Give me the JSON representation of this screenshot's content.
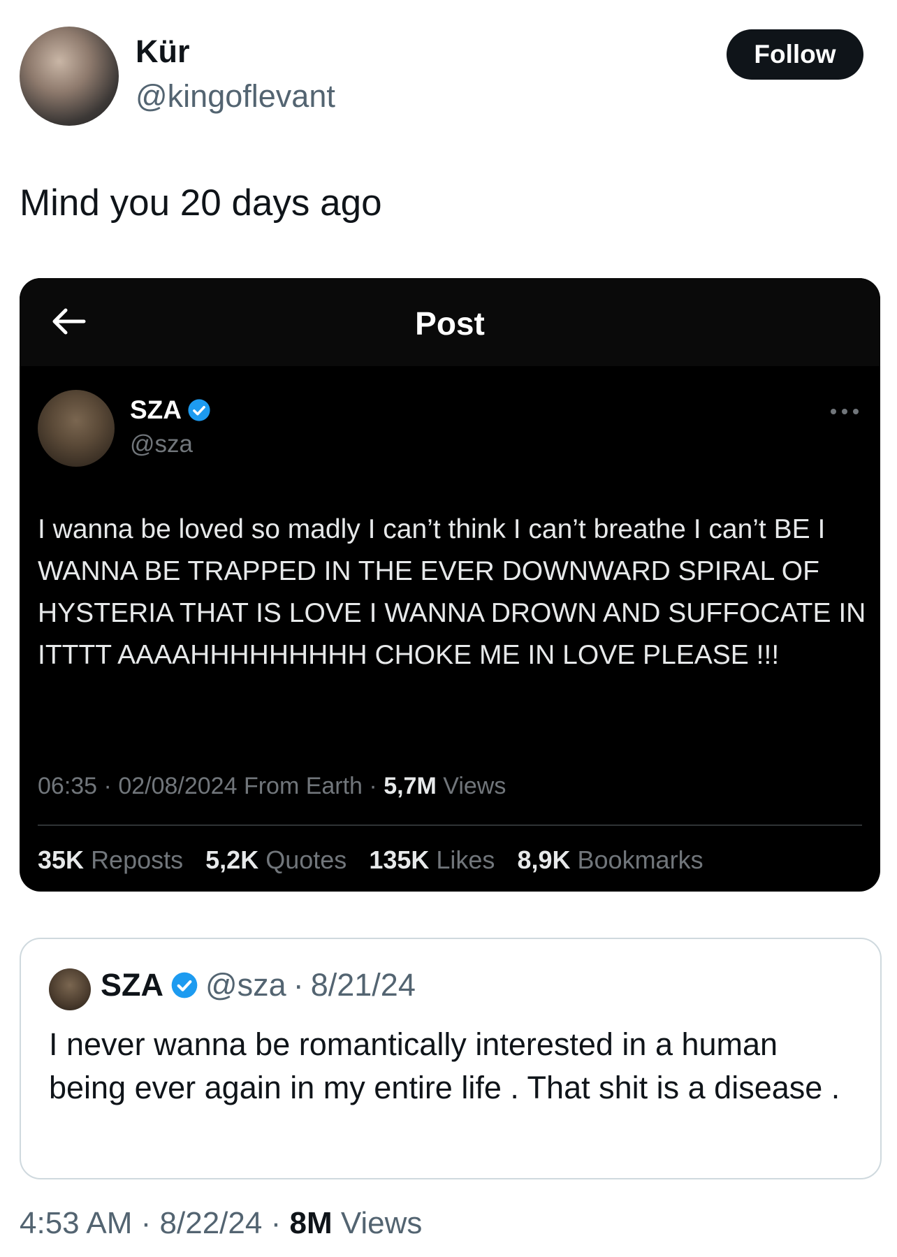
{
  "author": {
    "name": "Kür",
    "handle": "@kingoflevant",
    "follow_label": "Follow"
  },
  "tweet": {
    "text": "Mind you 20 days ago"
  },
  "screenshot": {
    "title": "Post",
    "user": {
      "name": "SZA",
      "handle": "@sza"
    },
    "text": "I wanna be loved so madly I can’t think I can’t breathe I can’t BE I WANNA BE TRAPPED IN THE EVER DOWNWARD SPIRAL OF HYSTERIA THAT IS LOVE I WANNA DROWN AND SUFFOCATE IN ITTTT AAAAHHHHHHHHH CHOKE ME IN LOVE PLEASE !!!",
    "meta": {
      "time": "06:35",
      "date": "02/08/2024",
      "source": "From Earth",
      "views": "5,7M",
      "views_label": "Views"
    },
    "stats": {
      "reposts": "35K",
      "reposts_label": "Reposts",
      "quotes": "5,2K",
      "quotes_label": "Quotes",
      "likes": "135K",
      "likes_label": "Likes",
      "bookmarks": "8,9K",
      "bookmarks_label": "Bookmarks"
    }
  },
  "quote": {
    "name": "SZA",
    "handle": "@sza",
    "date": "8/21/24",
    "text": "I never wanna be romantically interested in a human being ever again in my entire life . That shit is a disease ."
  },
  "footer": {
    "time": "4:53 AM",
    "date": "8/22/24",
    "views": "8M",
    "views_label": "Views"
  },
  "colors": {
    "verified": "#1d9bf0",
    "text": "#0f1419",
    "muted": "#536471",
    "dark_bg": "#000000"
  }
}
